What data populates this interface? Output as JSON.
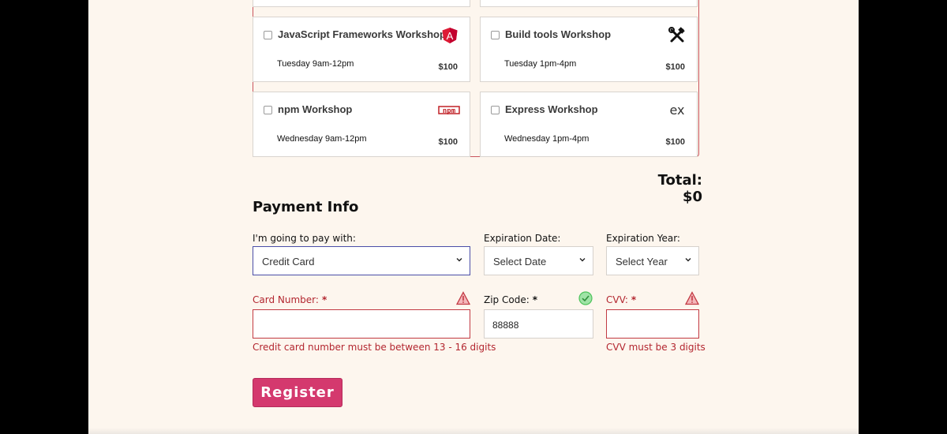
{
  "activities": [
    {
      "name": "JavaScript Frameworks Workshop",
      "time": "Tuesday 9am-12pm",
      "price": "$100",
      "icon": "angular-icon",
      "checked": false
    },
    {
      "name": "Build tools Workshop",
      "time": "Tuesday 1pm-4pm",
      "price": "$100",
      "icon": "tools-icon",
      "checked": false
    },
    {
      "name": "npm Workshop",
      "time": "Wednesday 9am-12pm",
      "price": "$100",
      "icon": "npm-icon",
      "checked": false
    },
    {
      "name": "Express Workshop",
      "time": "Wednesday 1pm-4pm",
      "price": "$100",
      "icon": "express-icon",
      "checked": false
    }
  ],
  "total": "Total: $0",
  "payment": {
    "title": "Payment Info",
    "method_label": "I'm going to pay with:",
    "method_value": "Credit Card",
    "exp_date_label": "Expiration Date:",
    "exp_date_value": "Select Date",
    "exp_year_label": "Expiration Year:",
    "exp_year_value": "Select Year",
    "card_label": "Card Number:",
    "card_value": "",
    "card_error": "Credit card number must be between 13 - 16 digits",
    "zip_label": "Zip Code:",
    "zip_value": "88888",
    "cvv_label": "CVV:",
    "cvv_value": "",
    "cvv_error": "CVV must be 3 digits",
    "required_marker": "*"
  },
  "register_label": "Register",
  "icons": {
    "angular_letter": "A",
    "npm_text": "npm",
    "express_text": "ex"
  },
  "colors": {
    "error": "#b3262f",
    "accent": "#d4396e",
    "focus": "#4a4ea8",
    "valid": "#4cc35a"
  }
}
